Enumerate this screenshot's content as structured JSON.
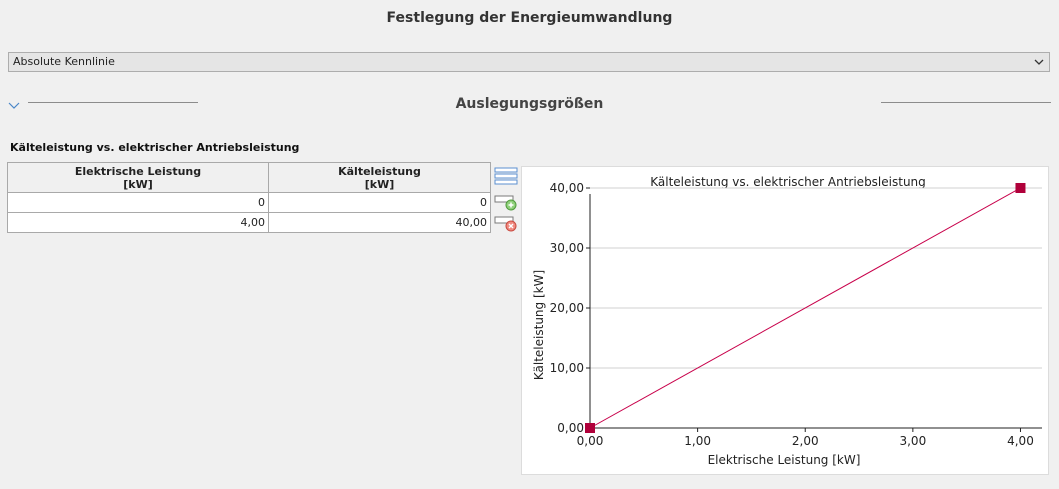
{
  "page": {
    "title": "Festlegung der Energieumwandlung"
  },
  "mode_select": {
    "value": "Absolute Kennlinie",
    "icon": "chevron-down-icon"
  },
  "section": {
    "title": "Auslegungsgrößen",
    "collapse_icon": "chevron-down-icon"
  },
  "table": {
    "caption": "Kälteleistung vs. elektrischer Antriebsleistung",
    "columns": [
      {
        "name": "Elektrische Leistung",
        "unit": "[kW]"
      },
      {
        "name": "Kälteleistung",
        "unit": "[kW]"
      }
    ],
    "rows": [
      [
        "0",
        "0"
      ],
      [
        "4,00",
        "40,00"
      ]
    ],
    "tools": [
      {
        "icon": "list-lines-icon"
      },
      {
        "icon": "add-row-icon"
      },
      {
        "icon": "remove-row-icon"
      }
    ]
  },
  "colors": {
    "series": "#c8004a",
    "marker": "#b0003a",
    "chevron": "#4a86c8"
  },
  "chart_data": {
    "type": "line",
    "title": "Kälteleistung vs. elektrischer Antriebsleistung",
    "xlabel": "Elektrische Leistung [kW]",
    "ylabel": "Kälteleistung [kW]",
    "xlim": [
      0,
      4.2
    ],
    "ylim": [
      0,
      42
    ],
    "x_ticks": [
      0,
      1,
      2,
      3,
      4
    ],
    "x_tick_labels": [
      "0,00",
      "1,00",
      "2,00",
      "3,00",
      "4,00"
    ],
    "y_ticks": [
      0,
      10,
      20,
      30,
      40
    ],
    "y_tick_labels": [
      "0,00",
      "10,00",
      "20,00",
      "30,00",
      "40,00"
    ],
    "grid": "horizontal",
    "series": [
      {
        "x": [
          0,
          4
        ],
        "y": [
          0,
          40
        ]
      }
    ]
  }
}
